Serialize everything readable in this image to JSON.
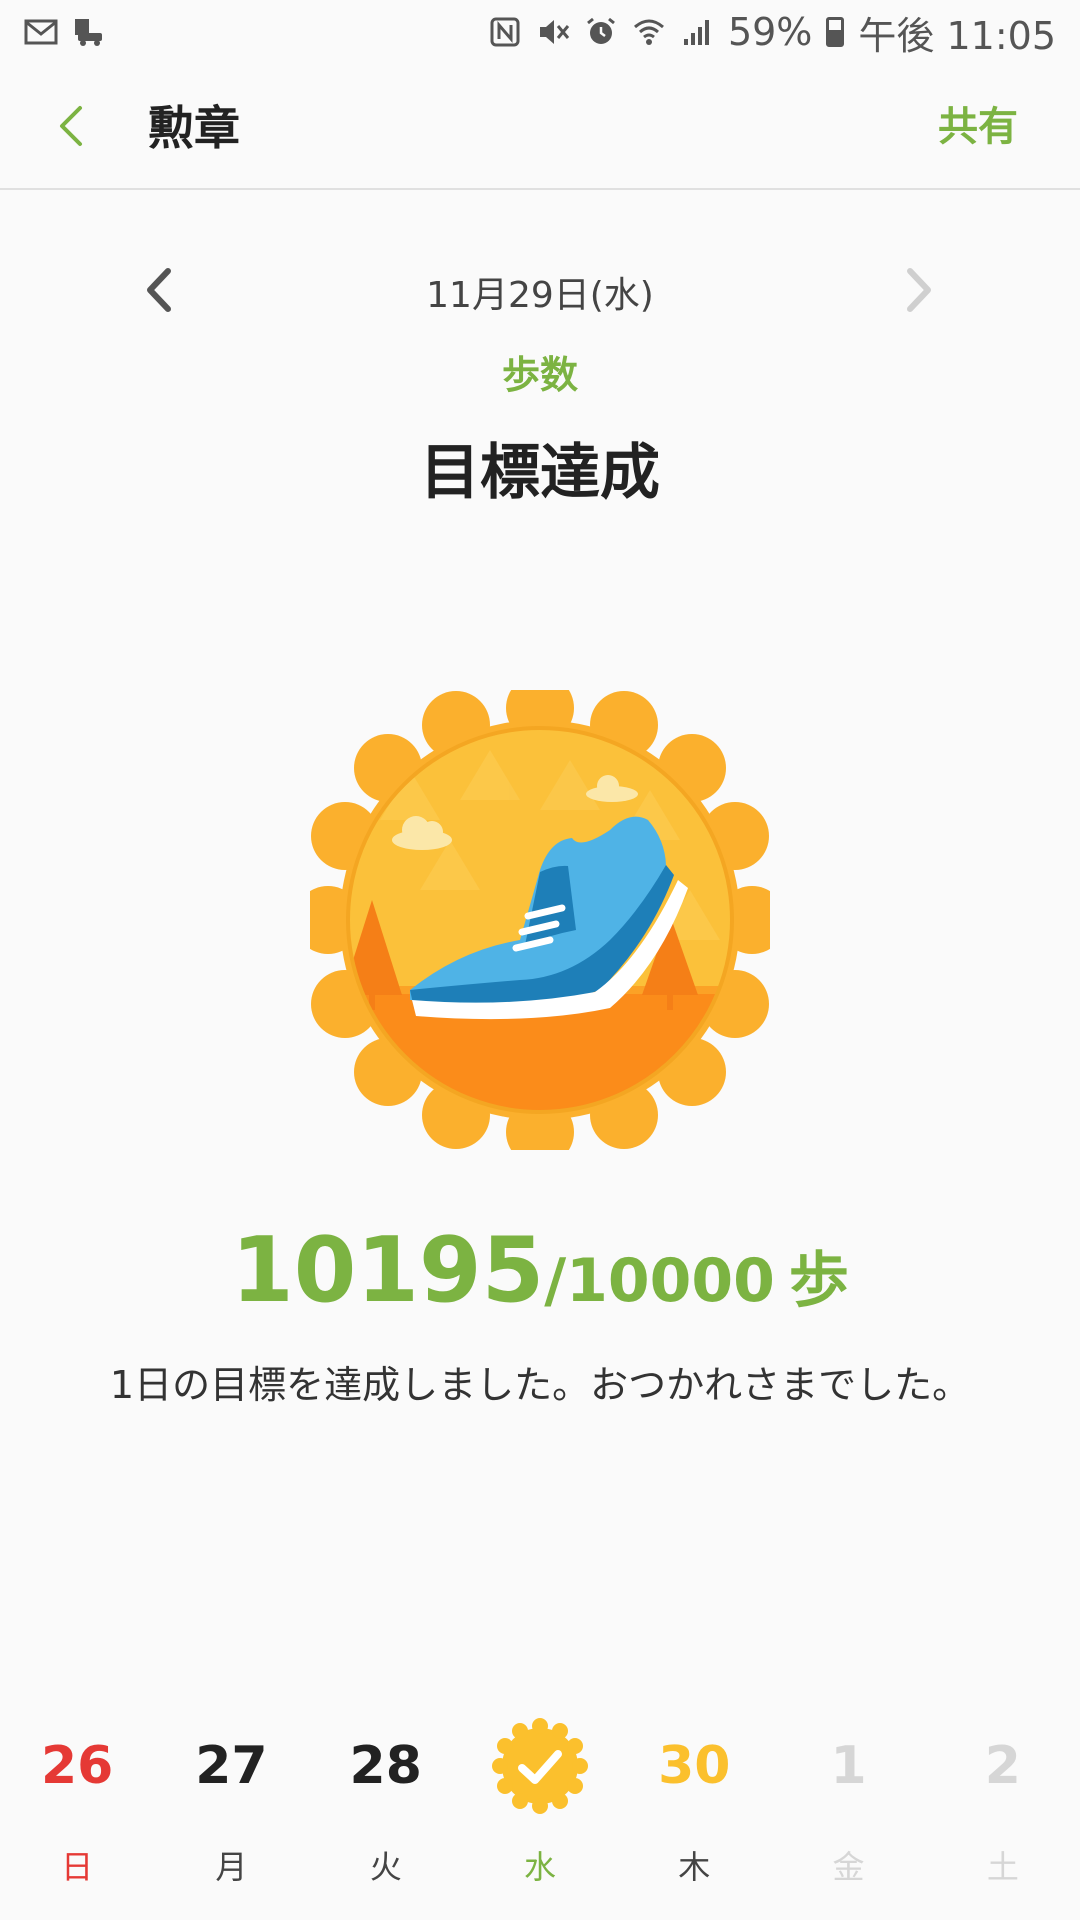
{
  "status_bar": {
    "battery": "59%",
    "time": "午後 11:05"
  },
  "app_bar": {
    "title": "勲章",
    "share": "共有"
  },
  "date": "11月29日(水)",
  "category": "歩数",
  "title": "目標達成",
  "steps": {
    "value": "10195",
    "goal": "/10000",
    "unit": "歩"
  },
  "message": "1日の目標を達成しました。おつかれさまでした。",
  "week": [
    {
      "num": "26",
      "name": "日",
      "color": "#e53935",
      "name_color": "#e53935"
    },
    {
      "num": "27",
      "name": "月",
      "color": "#222222",
      "name_color": "#444444"
    },
    {
      "num": "28",
      "name": "火",
      "color": "#222222",
      "name_color": "#444444"
    },
    {
      "num": "",
      "name": "水",
      "color": "#fbc02d",
      "name_color": "#7cb342",
      "badge": "check-badge-icon"
    },
    {
      "num": "30",
      "name": "木",
      "color": "#fbc02d",
      "name_color": "#444444"
    },
    {
      "num": "1",
      "name": "金",
      "color": "#d6d6d6",
      "name_color": "#d6d6d6"
    },
    {
      "num": "2",
      "name": "土",
      "color": "#d6d6d6",
      "name_color": "#d6d6d6"
    }
  ],
  "colors": {
    "accent": "#7cb342",
    "badge_orange": "#fbb02d"
  }
}
